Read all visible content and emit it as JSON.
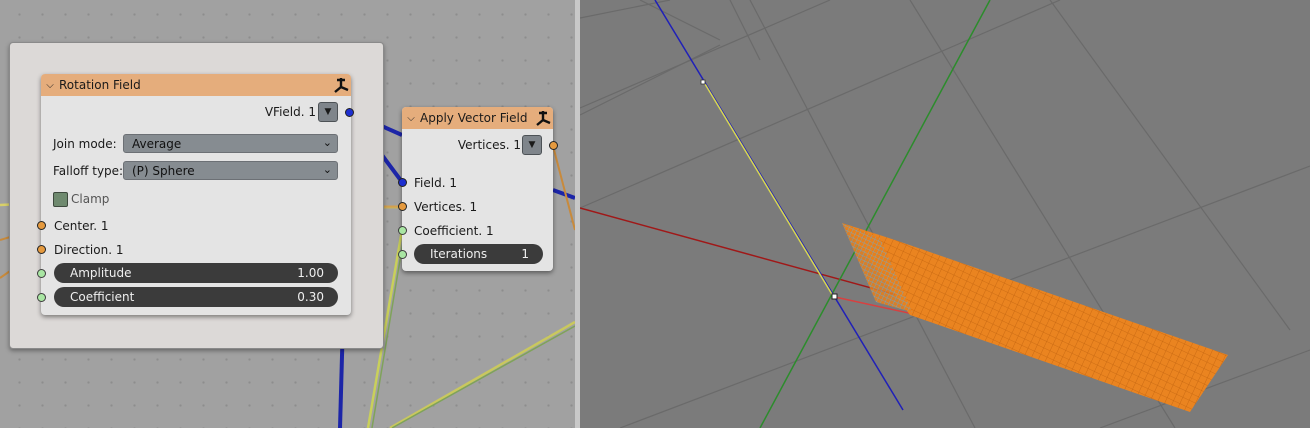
{
  "rotation_node": {
    "title": "Rotation Field",
    "output_label": "VField. 1",
    "join_mode_label": "Join mode:",
    "join_mode_value": "Average",
    "falloff_label": "Falloff type:",
    "falloff_value": "(P) Sphere",
    "clamp_label": "Clamp",
    "center_label": "Center. 1",
    "direction_label": "Direction. 1",
    "amplitude_label": "Amplitude",
    "amplitude_value": "1.00",
    "coefficient_label": "Coefficient",
    "coefficient_value": "0.30"
  },
  "apply_node": {
    "title": "Apply Vector Field",
    "output_label": "Vertices. 1",
    "field_label": "Field. 1",
    "vertices_label": "Vertices. 1",
    "coefficient_label": "Coefficient. 1",
    "iterations_label": "Iterations",
    "iterations_value": "1"
  },
  "icons": {
    "node_header_icon": "sverchok-icon",
    "collapse": "chevron-down-icon",
    "output_menu": "triangle-down-icon"
  },
  "colors": {
    "node_header": "#e5ad7c",
    "vector_socket": "#1d2fd0",
    "vertices_socket": "#e59a3f",
    "float_socket": "#a9e6a3",
    "mesh": "#e8801c",
    "x_axis": "#c01010",
    "y_axis": "#2e8b2e",
    "z_axis": "#2020c8"
  }
}
